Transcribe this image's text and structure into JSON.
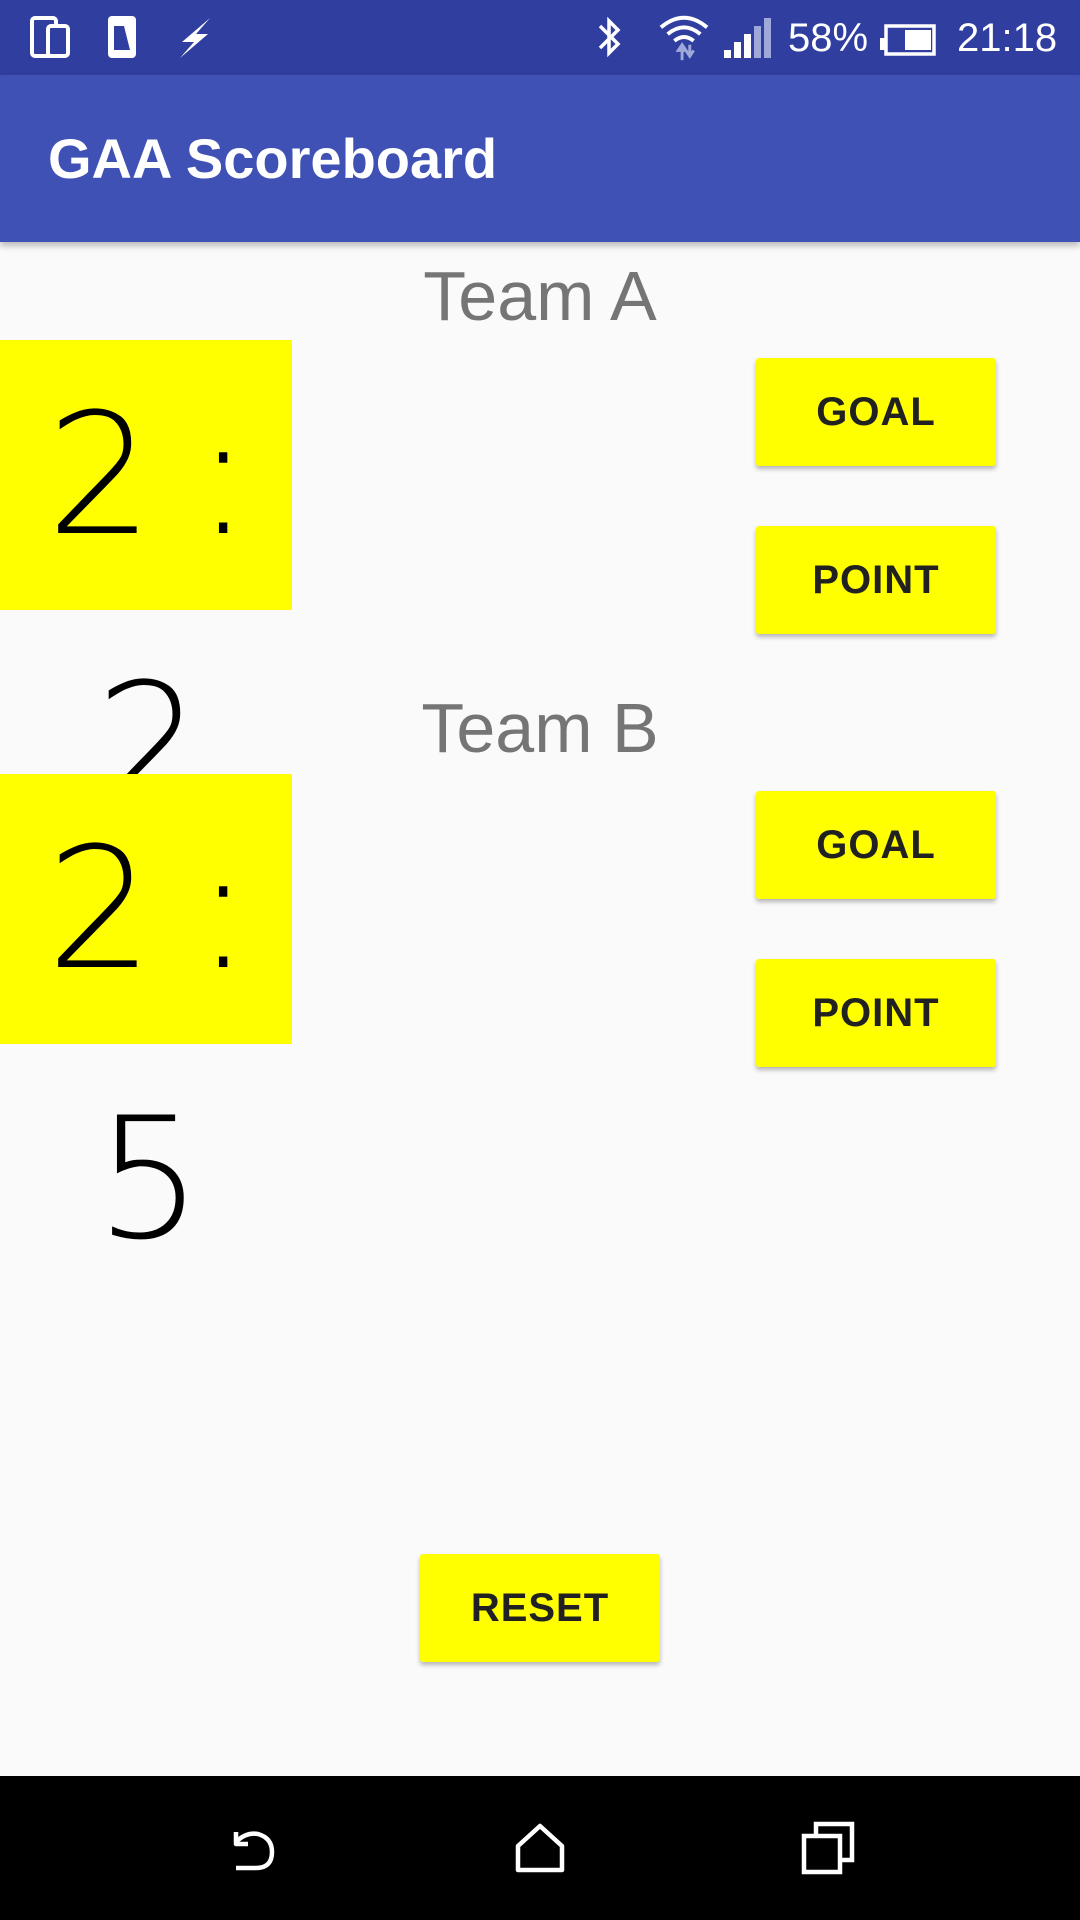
{
  "status_bar": {
    "battery_percent": "58%",
    "time": "21:18",
    "icons": [
      "device-icon",
      "phone-icon",
      "flash-icon",
      "bluetooth-icon",
      "wifi-icon",
      "signal-icon",
      "battery-icon"
    ]
  },
  "app_bar": {
    "title": "GAA Scoreboard"
  },
  "team_a": {
    "name": "Team A",
    "score": "2 : 2",
    "goal_label": "GOAL",
    "point_label": "POINT"
  },
  "team_b": {
    "name": "Team B",
    "score": "2 : 5",
    "goal_label": "GOAL",
    "point_label": "POINT"
  },
  "reset_label": "RESET",
  "nav_bar": {
    "icons": [
      "back-icon",
      "home-icon",
      "recents-icon"
    ]
  },
  "colors": {
    "status_bar": "#303f9f",
    "app_bar": "#3f51b5",
    "accent_yellow": "#ffff00",
    "team_label": "#757575",
    "background": "#fafafa"
  }
}
